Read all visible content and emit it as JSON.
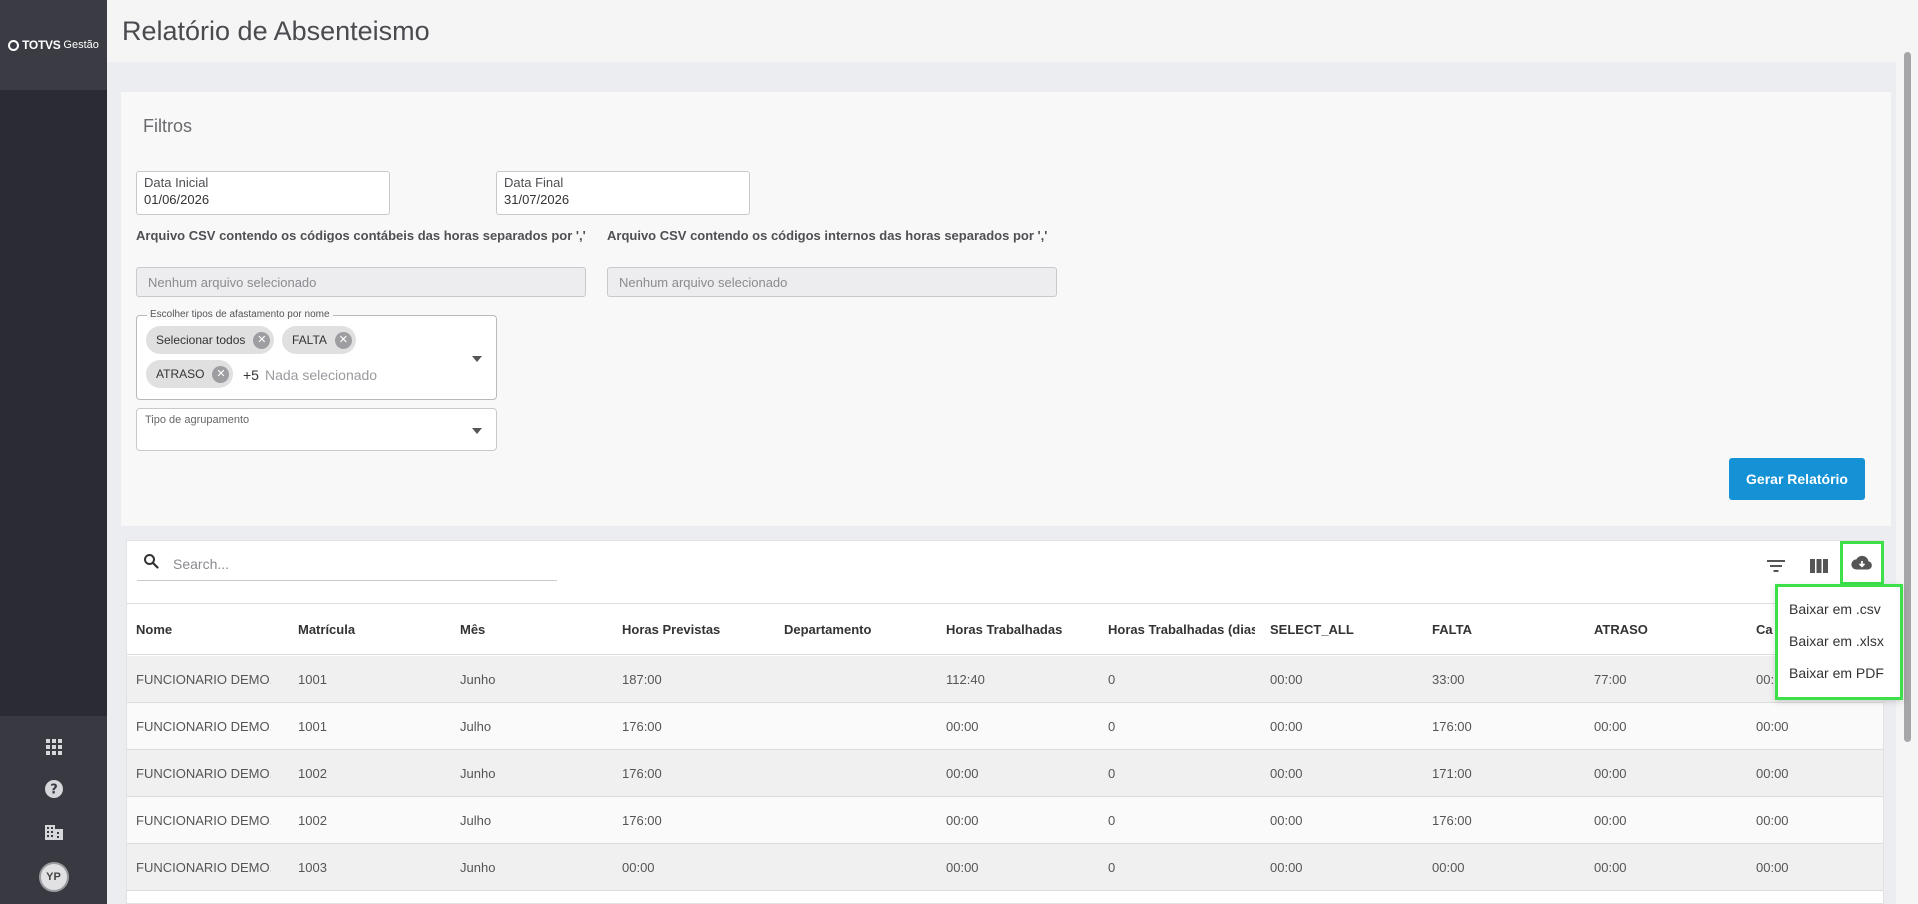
{
  "sidebar": {
    "logo_brand": "TOTVS",
    "logo_suffix": "Gestão",
    "items": [
      {
        "icon": "apps-grid-icon"
      },
      {
        "icon": "help-icon"
      },
      {
        "icon": "company-building-icon"
      }
    ],
    "avatar_initials": "YP"
  },
  "header": {
    "title": "Relatório de Absenteismo"
  },
  "filters": {
    "title": "Filtros",
    "start_date": {
      "label": "Data Inicial",
      "value": "01/06/2026"
    },
    "end_date": {
      "label": "Data Final",
      "value": "31/07/2026"
    },
    "csv_accounting": {
      "label": "Arquivo CSV contendo os códigos contábeis das horas separados por ','",
      "placeholder": "Nenhum arquivo selecionado"
    },
    "csv_internal": {
      "label": "Arquivo CSV contendo os códigos internos das horas separados por ','",
      "placeholder": "Nenhum arquivo selecionado"
    },
    "leave_types": {
      "legend": "Escolher tipos de afastamento por nome",
      "chips": [
        "Selecionar todos",
        "FALTA",
        "ATRASO"
      ],
      "more": "+5",
      "placeholder": "Nada selecionado"
    },
    "grouping": {
      "legend": "Tipo de agrupamento",
      "value": ""
    },
    "generate_button": "Gerar Relatório"
  },
  "table": {
    "search_placeholder": "Search...",
    "columns": [
      "Nome",
      "Matrícula",
      "Mês",
      "Horas Previstas",
      "Departamento",
      "Horas Trabalhadas",
      "Horas Trabalhadas (dias",
      "SELECT_ALL",
      "FALTA",
      "ATRASO",
      "Ca"
    ],
    "rows": [
      [
        "FUNCIONARIO DEMO...",
        "1001",
        "Junho",
        "187:00",
        "",
        "112:40",
        "0",
        "00:00",
        "33:00",
        "77:00",
        "00:"
      ],
      [
        "FUNCIONARIO DEMO...",
        "1001",
        "Julho",
        "176:00",
        "",
        "00:00",
        "0",
        "00:00",
        "176:00",
        "00:00",
        "00:00"
      ],
      [
        "FUNCIONARIO DEMO...",
        "1002",
        "Junho",
        "176:00",
        "",
        "00:00",
        "0",
        "00:00",
        "171:00",
        "00:00",
        "00:00"
      ],
      [
        "FUNCIONARIO DEMO...",
        "1002",
        "Julho",
        "176:00",
        "",
        "00:00",
        "0",
        "00:00",
        "176:00",
        "00:00",
        "00:00"
      ],
      [
        "FUNCIONARIO DEMO...",
        "1003",
        "Junho",
        "00:00",
        "",
        "00:00",
        "0",
        "00:00",
        "00:00",
        "00:00",
        "00:00"
      ]
    ]
  },
  "download_menu": {
    "items": [
      "Baixar em .csv",
      "Baixar em .xlsx",
      "Baixar em PDF"
    ]
  },
  "colors": {
    "primary": "#1592d6",
    "sidebar": "#2b2c33",
    "highlight": "#3ee04a"
  }
}
